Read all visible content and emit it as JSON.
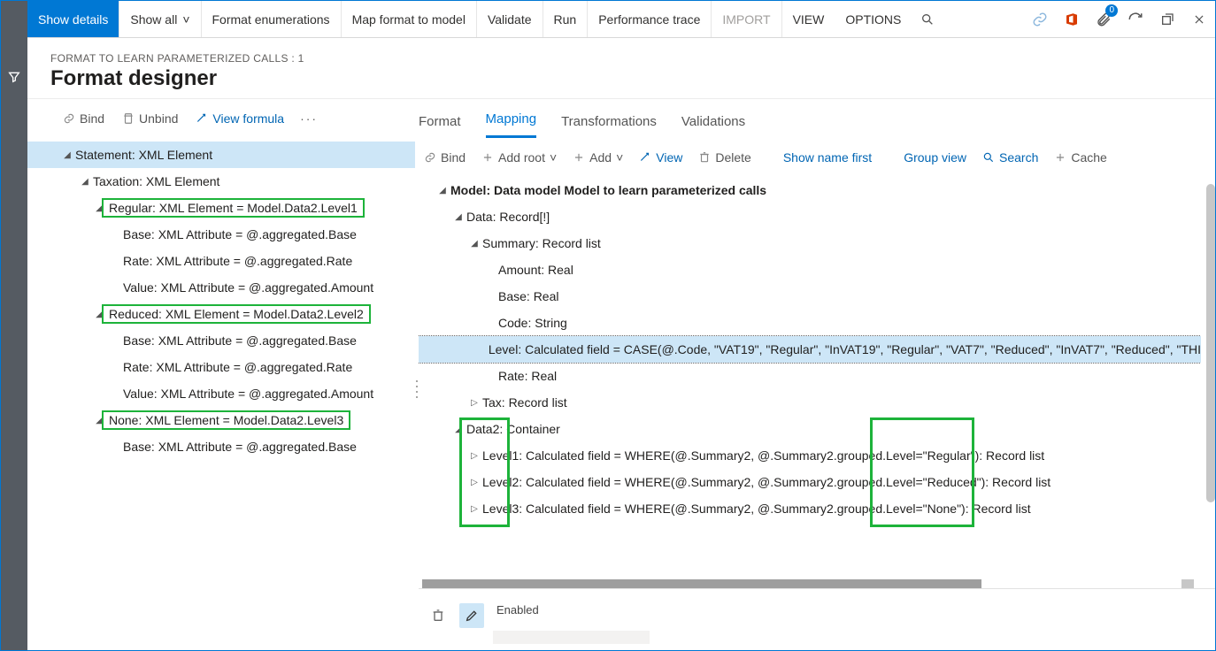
{
  "toolbar": {
    "show_details": "Show details",
    "show_all": "Show all",
    "format_enum": "Format enumerations",
    "map_format": "Map format to model",
    "validate": "Validate",
    "run": "Run",
    "perf_trace": "Performance trace",
    "import": "IMPORT",
    "view": "VIEW",
    "options": "OPTIONS",
    "badge_count": "0"
  },
  "header": {
    "breadcrumb": "FORMAT TO LEARN PARAMETERIZED CALLS : 1",
    "title": "Format designer"
  },
  "left_actions": {
    "bind": "Bind",
    "unbind": "Unbind",
    "view_formula": "View formula"
  },
  "left_tree": {
    "n0": "Statement: XML Element",
    "n1": "Taxation: XML Element",
    "n2": "Regular: XML Element = Model.Data2.Level1",
    "n2a": "Base: XML Attribute = @.aggregated.Base",
    "n2b": "Rate: XML Attribute = @.aggregated.Rate",
    "n2c": "Value: XML Attribute = @.aggregated.Amount",
    "n3": "Reduced: XML Element = Model.Data2.Level2",
    "n3a": "Base: XML Attribute = @.aggregated.Base",
    "n3b": "Rate: XML Attribute = @.aggregated.Rate",
    "n3c": "Value: XML Attribute = @.aggregated.Amount",
    "n4": "None: XML Element = Model.Data2.Level3",
    "n4a": "Base: XML Attribute = @.aggregated.Base"
  },
  "tabs": {
    "format": "Format",
    "mapping": "Mapping",
    "transformations": "Transformations",
    "validations": "Validations"
  },
  "right_actions": {
    "bind": "Bind",
    "add_root": "Add root",
    "add": "Add",
    "view": "View",
    "delete": "Delete",
    "show_name": "Show name first",
    "group_view": "Group view",
    "search": "Search",
    "cache": "Cache"
  },
  "right_tree": {
    "m0": "Model: Data model Model to learn parameterized calls",
    "m1": "Data: Record[!]",
    "m2": "Summary: Record list",
    "m2a": "Amount: Real",
    "m2b": "Base: Real",
    "m2c": "Code: String",
    "m2d": "Level: Calculated field = CASE(@.Code, \"VAT19\", \"Regular\", \"InVAT19\", \"Regular\", \"VAT7\", \"Reduced\", \"InVAT7\", \"Reduced\", \"THI",
    "m2e": "Rate: Real",
    "m3": "Tax: Record list",
    "m4": "Data2: Container",
    "m4a": "Level1: Calculated field = WHERE(@.Summary2, @.Summary2.grouped.Level=\"Regular\"): Record list",
    "m4b": "Level2: Calculated field = WHERE(@.Summary2, @.Summary2.grouped.Level=\"Reduced\"): Record list",
    "m4c": "Level3: Calculated field = WHERE(@.Summary2, @.Summary2.grouped.Level=\"None\"): Record list"
  },
  "prop": {
    "enabled": "Enabled"
  }
}
